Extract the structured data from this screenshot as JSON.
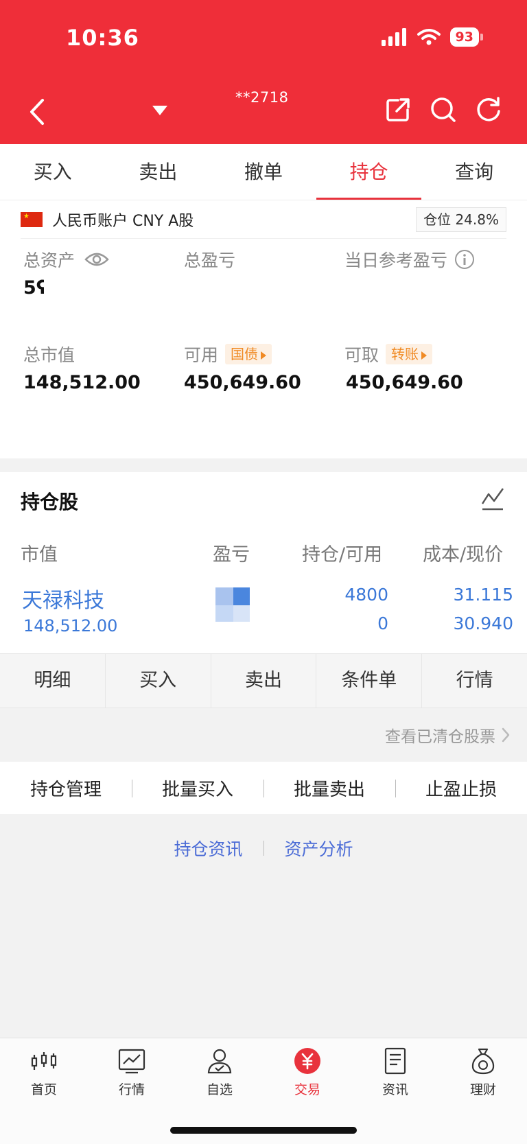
{
  "status": {
    "time": "10:36",
    "battery": "93"
  },
  "header": {
    "account_no": "**2718"
  },
  "tabs": [
    {
      "label": "买入"
    },
    {
      "label": "卖出"
    },
    {
      "label": "撤单"
    },
    {
      "label": "持仓",
      "active": true
    },
    {
      "label": "查询"
    }
  ],
  "account": {
    "name": "人民币账户 CNY A股",
    "position_label": "仓位",
    "position_value": "24.8%",
    "total_assets_label": "总资产",
    "total_assets_value": "5ʕ",
    "total_pl_label": "总盈亏",
    "daily_pl_label": "当日参考盈亏",
    "market_value_label": "总市值",
    "market_value": "148,512.00",
    "available_label": "可用",
    "available_tag": "国债",
    "available_value": "450,649.60",
    "withdrawable_label": "可取",
    "withdrawable_tag": "转账",
    "withdrawable_value": "450,649.60"
  },
  "holdings": {
    "title": "持仓股",
    "columns": [
      "市值",
      "盈亏",
      "持仓/可用",
      "成本/现价"
    ],
    "rows": [
      {
        "name": "天禄科技",
        "market_value": "148,512.00",
        "position": "4800",
        "available": "0",
        "cost": "31.115",
        "price": "30.940"
      }
    ]
  },
  "row_actions": [
    "明细",
    "买入",
    "卖出",
    "条件单",
    "行情"
  ],
  "cleared_link": "查看已清仓股票",
  "manage": [
    "持仓管理",
    "批量买入",
    "批量卖出",
    "止盈止损"
  ],
  "info_links": [
    "持仓资讯",
    "资产分析"
  ],
  "bottom_nav": [
    {
      "label": "首页",
      "icon": "candlestick-icon"
    },
    {
      "label": "行情",
      "icon": "line-chart-icon"
    },
    {
      "label": "自选",
      "icon": "user-check-icon"
    },
    {
      "label": "交易",
      "icon": "yuan-icon",
      "active": true
    },
    {
      "label": "资讯",
      "icon": "document-icon"
    },
    {
      "label": "理财",
      "icon": "money-bag-icon"
    }
  ],
  "colors": {
    "brand_red": "#ef2e39",
    "link_blue": "#3b78d8",
    "tag_orange": "#f08a24"
  }
}
